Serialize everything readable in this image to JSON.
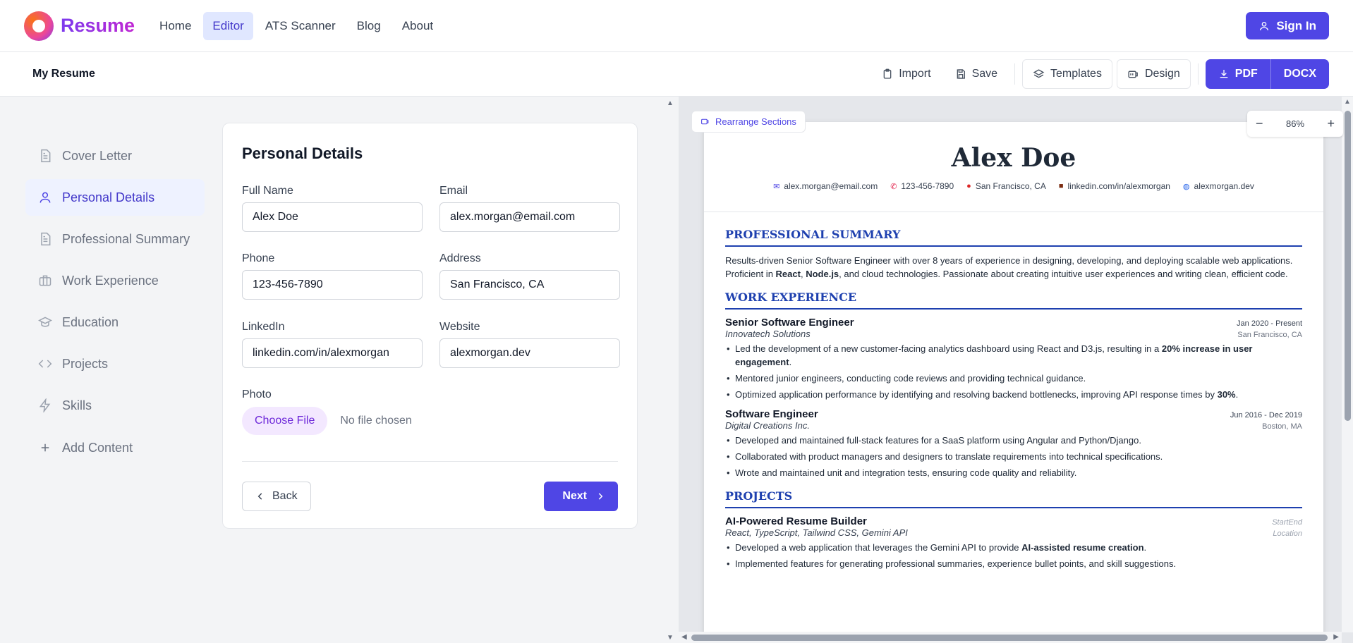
{
  "brand": {
    "name": "Resume"
  },
  "nav": {
    "items": [
      "Home",
      "Editor",
      "ATS Scanner",
      "Blog",
      "About"
    ],
    "active": "Editor"
  },
  "header": {
    "sign_in": "Sign In"
  },
  "toolbar": {
    "doc_title": "My Resume",
    "import": "Import",
    "save": "Save",
    "templates": "Templates",
    "design": "Design",
    "pdf": "PDF",
    "docx": "DOCX"
  },
  "sidebar": {
    "items": [
      {
        "label": "Cover Letter",
        "icon": "document-icon"
      },
      {
        "label": "Personal Details",
        "icon": "user-icon"
      },
      {
        "label": "Professional Summary",
        "icon": "document-icon"
      },
      {
        "label": "Work Experience",
        "icon": "briefcase-icon"
      },
      {
        "label": "Education",
        "icon": "graduation-cap-icon"
      },
      {
        "label": "Projects",
        "icon": "code-icon"
      },
      {
        "label": "Skills",
        "icon": "lightning-icon"
      }
    ],
    "active": "Personal Details",
    "add_content": "Add Content"
  },
  "form": {
    "title": "Personal Details",
    "full_name": {
      "label": "Full Name",
      "value": "Alex Doe"
    },
    "email": {
      "label": "Email",
      "value": "alex.morgan@email.com"
    },
    "phone": {
      "label": "Phone",
      "value": "123-456-7890"
    },
    "address": {
      "label": "Address",
      "value": "San Francisco, CA"
    },
    "linkedin": {
      "label": "LinkedIn",
      "value": "linkedin.com/in/alexmorgan"
    },
    "website": {
      "label": "Website",
      "value": "alexmorgan.dev"
    },
    "photo": {
      "label": "Photo",
      "button": "Choose File",
      "status": "No file chosen"
    },
    "back": "Back",
    "next": "Next"
  },
  "preview": {
    "rearrange": "Rearrange Sections",
    "zoom": "86%",
    "resume": {
      "name": "Alex Doe",
      "contacts": {
        "email": "alex.morgan@email.com",
        "phone": "123-456-7890",
        "location": "San Francisco, CA",
        "linkedin": "linkedin.com/in/alexmorgan",
        "website": "alexmorgan.dev"
      },
      "summary_title": "PROFESSIONAL SUMMARY",
      "summary": {
        "a": "Results-driven Senior Software Engineer with over 8 years of experience in designing, developing, and deploying scalable web applications. Proficient in ",
        "b1": "React",
        "c": ", ",
        "b2": "Node.js",
        "d": ", and cloud technologies. Passionate about creating intuitive user experiences and writing clean, efficient code."
      },
      "work_title": "WORK EXPERIENCE",
      "jobs": [
        {
          "title": "Senior Software Engineer",
          "date": "Jan 2020 - Present",
          "company": "Innovatech Solutions",
          "location": "San Francisco, CA",
          "b1a": "Led the development of a new customer-facing analytics dashboard using React and D3.js, resulting in a ",
          "b1b": "20% increase in user engagement",
          "b1c": ".",
          "b2": "Mentored junior engineers, conducting code reviews and providing technical guidance.",
          "b3a": "Optimized application performance by identifying and resolving backend bottlenecks, improving API response times by ",
          "b3b": "30%",
          "b3c": "."
        },
        {
          "title": "Software Engineer",
          "date": "Jun 2016 - Dec 2019",
          "company": "Digital Creations Inc.",
          "location": "Boston, MA",
          "b1": "Developed and maintained full-stack features for a SaaS platform using Angular and Python/Django.",
          "b2": "Collaborated with product managers and designers to translate requirements into technical specifications.",
          "b3": "Wrote and maintained unit and integration tests, ensuring code quality and reliability."
        }
      ],
      "projects_title": "PROJECTS",
      "project": {
        "title": "AI-Powered Resume Builder",
        "date": "StartEnd",
        "tech": "React, TypeScript, Tailwind CSS, Gemini API",
        "location": "Location",
        "b1a": "Developed a web application that leverages the Gemini API to provide ",
        "b1b": "AI-assisted resume creation",
        "b1c": ".",
        "b2": "Implemented features for generating professional summaries, experience bullet points, and skill suggestions."
      }
    }
  },
  "colors": {
    "accent": "#4f46e5",
    "heading": "#1e40af"
  }
}
